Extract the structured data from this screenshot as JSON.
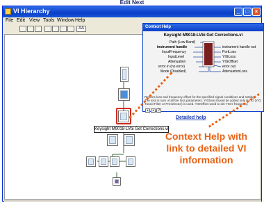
{
  "edit_label": "Edit Next",
  "window": {
    "title": "VI Hierarchy",
    "menu": [
      "File",
      "Edit",
      "View",
      "Tools",
      "Window",
      "Help"
    ],
    "toolbar_dropdown": "AA"
  },
  "context_help": {
    "title": "Context Help",
    "vi_name": "Keysight M9018-LVbi Get Corrections.vi",
    "left_terminals": [
      "Path (Low Band)",
      "instrument handle",
      "InputFrequency",
      "InputLevel",
      "Attenuation",
      "error in (no error)",
      "Mode (Disabled)"
    ],
    "right_terminals": [
      "instrument handle out",
      "PortLoss",
      "YIGLoss",
      "YIGOffset",
      "error out",
      "AttenuationLoss"
    ],
    "description": "Returns loss and frequency offset for the specified signal conditions and settings. The loss is sum of all the loss parameters. YIGloss should be added only if YIG (YIG Tuned Filter or Preselector) is used. YIGOffset used to set YIG's frequency.",
    "link_text": "Detailed help"
  },
  "diagram": {
    "selected_vi_label": "Keysight M9018-LVbi Get Corrections.vi"
  },
  "callout": {
    "text": "Context Help with link to detailed VI information",
    "color": "#e86214"
  }
}
